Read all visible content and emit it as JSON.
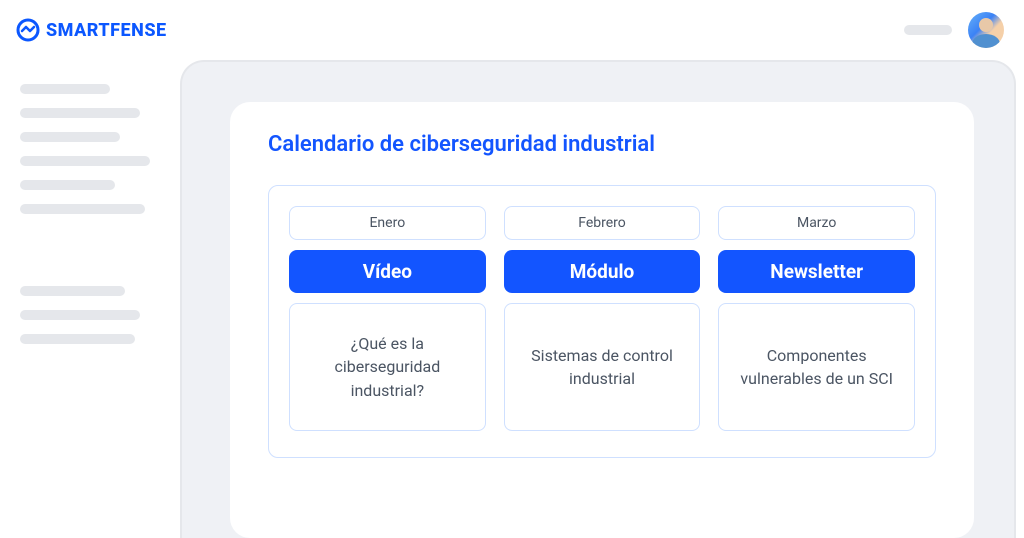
{
  "brand": {
    "name": "SMARTFENSE"
  },
  "page": {
    "title": "Calendario de ciberseguridad industrial"
  },
  "columns": [
    {
      "month": "Enero",
      "type": "Vídeo",
      "topic": "¿Qué es la ciberseguridad industrial?"
    },
    {
      "month": "Febrero",
      "type": "Módulo",
      "topic": "Sistemas de control industrial"
    },
    {
      "month": "Marzo",
      "type": "Newsletter",
      "topic": "Componentes vulnerables de un SCI"
    }
  ]
}
